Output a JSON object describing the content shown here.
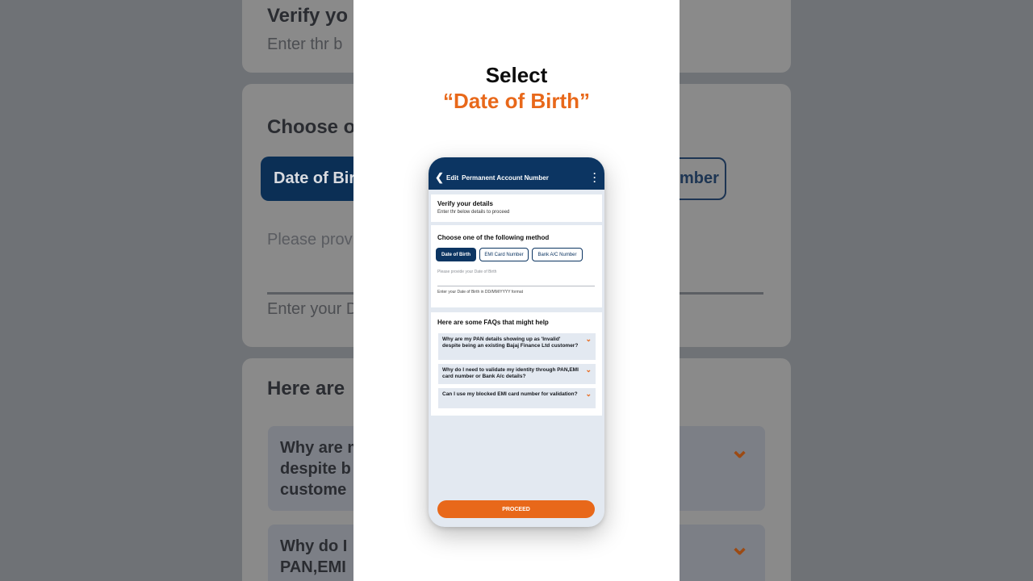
{
  "overlay": {
    "line1": "Select",
    "line2": "“Date of Birth”"
  },
  "appbar": {
    "back_icon": "chevron-left-icon",
    "edit": "Edit",
    "title": "Permanent Account Number",
    "more_icon": "more-vertical-icon"
  },
  "verify": {
    "title": "Verify your details",
    "subtitle": "Enter thr below details to proceed"
  },
  "method": {
    "title": "Choose one of the following method",
    "options": [
      "Date of Birth",
      "EMI Card Number",
      "Bank A/C Number"
    ],
    "selected": "Date of Birth",
    "input_label": "Please provide your Date of Birth",
    "input_hint": "Enter your Date of Birth in DD/MM/YYYY format"
  },
  "faqs": {
    "title": "Here are some FAQs that might help",
    "items": [
      "Why are my PAN details showing up as 'Invalid' despite being an existing Bajaj Finance Ltd customer?",
      "Why do I need to validate my identity through PAN,EMI card number or Bank A/c details?",
      "Can I use my blocked EMI card number for validation?"
    ]
  },
  "actions": {
    "proceed": "PROCEED"
  },
  "background": {
    "verify_title": "Verify yo",
    "verify_sub": "Enter thr b",
    "method_title": "Choose o",
    "chip_dob": "Date of Bir",
    "chip_bank": "mber",
    "input_label": "Please provi",
    "input_hint": "Enter your Da",
    "faq_title": "Here are",
    "faq1": [
      "Why are m",
      "despite b",
      "custome"
    ],
    "faq2": [
      "Why do I",
      "PAN,EMI"
    ]
  },
  "colors": {
    "navy": "#0c3562",
    "orange": "#e8681a",
    "app_bg": "#e3e9f1"
  }
}
